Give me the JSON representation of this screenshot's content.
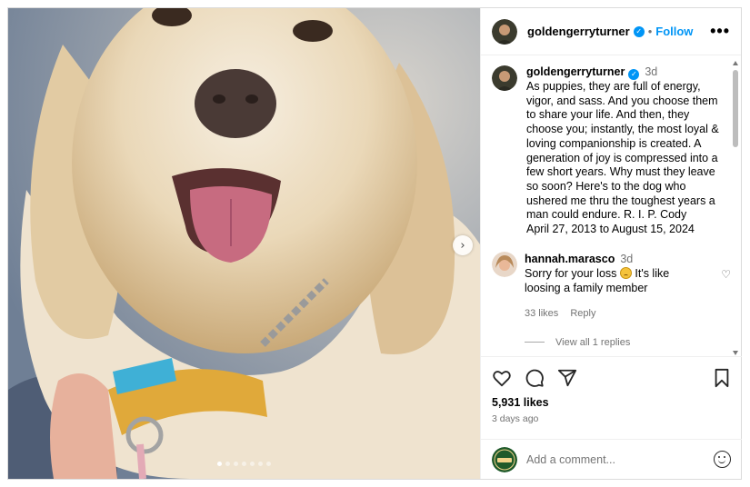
{
  "post": {
    "username": "goldengerryturner",
    "follow_label": "Follow",
    "separator": "•",
    "more_label": "•••",
    "verified_mark": "✓"
  },
  "media": {
    "description": "dog-photo",
    "next_label": "›",
    "dot_count": 7,
    "active_dot": 0
  },
  "caption": {
    "username": "goldengerryturner",
    "time": "3d",
    "text": "As puppies, they are full of energy, vigor, and sass. And you choose them to share your life. And then, they choose you; instantly, the most loyal & loving companionship is created. A generation of joy is compressed into a few short years. Why must they leave so soon? Here's to the dog who ushered me thru the toughest years a man could endure. R. I. P. Cody",
    "dates": "April 27, 2013 to August 15, 2024"
  },
  "comment": {
    "username": "hannah.marasco",
    "time": "3d",
    "text_before": "Sorry for your loss",
    "text_after": " It's like loosing a family member",
    "likes": "33 likes",
    "reply_label": "Reply",
    "view_replies": "View all 1 replies",
    "heart": "♡"
  },
  "actions": {
    "likes": "5,931 likes",
    "posted": "3 days ago"
  },
  "add_comment": {
    "placeholder": "Add a comment..."
  },
  "colors": {
    "accent": "#0095f6",
    "muted": "#737373",
    "border": "#dbdbdb"
  },
  "icons": [
    "verified-icon",
    "more-options-icon",
    "chevron-right-icon",
    "heart-icon",
    "comment-icon",
    "share-icon",
    "bookmark-icon",
    "emoji-icon"
  ]
}
